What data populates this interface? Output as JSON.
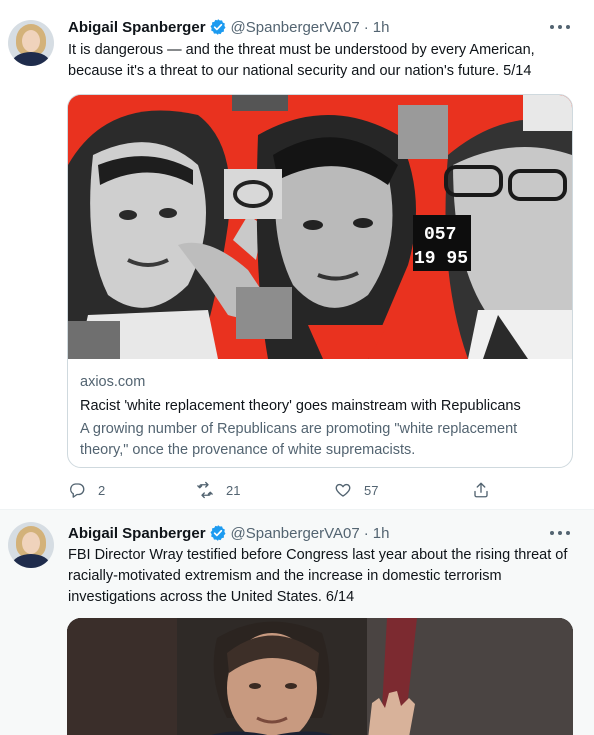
{
  "tweets": [
    {
      "author": {
        "name": "Abigail Spanberger",
        "handle": "@SpanbergerVA07",
        "time": "1h",
        "verified_icon": "verified-badge-icon"
      },
      "text": "It is dangerous — and the threat must be understood by every American, because it's a threat to our national security and our nation's future. 5/14",
      "card": {
        "domain": "axios.com",
        "title": "Racist 'white replacement theory' goes mainstream with Republicans",
        "description": "A growing number of Republicans are promoting \"white replacement theory,\" once the provenance of white supremacists.",
        "image_text": [
          "057",
          "19 95"
        ]
      },
      "actions": {
        "reply_count": "2",
        "retweet_count": "21",
        "like_count": "57"
      }
    },
    {
      "author": {
        "name": "Abigail Spanberger",
        "handle": "@SpanbergerVA07",
        "time": "1h",
        "verified_icon": "verified-badge-icon"
      },
      "text": "FBI Director Wray testified before Congress last year about the rising threat of racially-motivated extremism and the increase in domestic terrorism investigations across the United States. 6/14"
    }
  ],
  "separator": "·",
  "colors": {
    "verified": "#1d9bf0",
    "secondary_text": "#536471",
    "thread_line": "#cfd9de",
    "card_image_red": "#e9321f"
  }
}
